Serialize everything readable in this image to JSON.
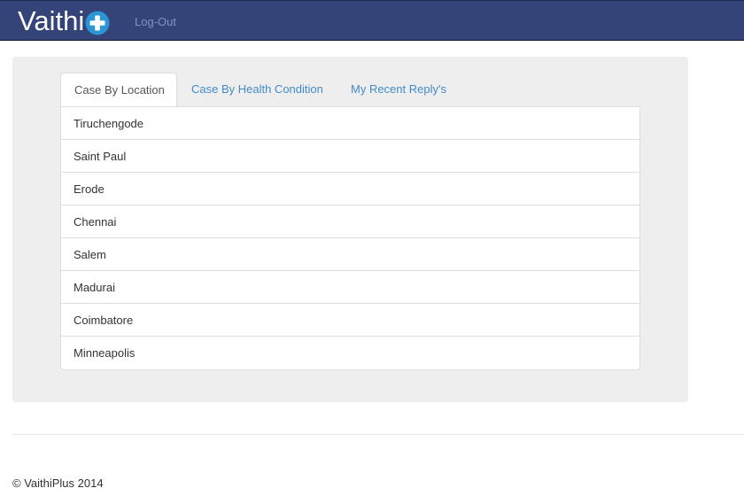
{
  "navbar": {
    "brand_text": "Vaithi",
    "brand_icon": "plus-circle-icon",
    "logout_label": "Log-Out",
    "colors": {
      "background": "#344478",
      "logout_link": "#7f93c7"
    }
  },
  "tabs": [
    {
      "label": "Case By Location",
      "active": true
    },
    {
      "label": "Case By Health Condition",
      "active": false
    },
    {
      "label": "My Recent Reply's",
      "active": false
    }
  ],
  "locations": [
    "Tiruchengode",
    "Saint Paul",
    "Erode",
    "Chennai",
    "Salem",
    "Madurai",
    "Coimbatore",
    "Minneapolis"
  ],
  "footer": {
    "copyright": "© VaithiPlus 2014"
  }
}
